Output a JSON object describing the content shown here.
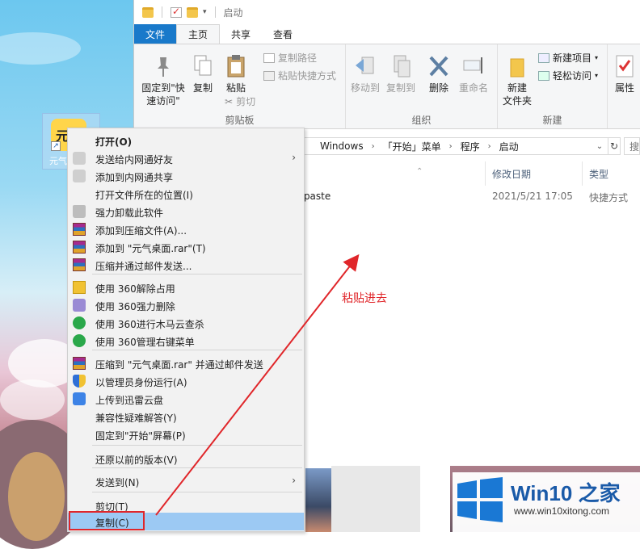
{
  "explorer": {
    "title": "启动",
    "tabs": [
      "文件",
      "主页",
      "共享",
      "查看"
    ],
    "ribbon": {
      "pin_label": "固定到\"快\n速访问\"",
      "copy_label": "复制",
      "paste_label": "粘贴",
      "copy_path_label": "复制路径",
      "paste_shortcut_label": "粘贴快捷方式",
      "cut_label": "剪切",
      "clipboard_group": "剪贴板",
      "move_to_label": "移动到",
      "copy_to_label": "复制到",
      "delete_label": "删除",
      "rename_label": "重命名",
      "organize_group": "组织",
      "new_item_label": "新建项目",
      "easy_access_label": "轻松访问",
      "new_folder_label": "新建\n文件夹",
      "new_group": "新建",
      "properties_label": "属性"
    },
    "address": {
      "crumbs": [
        "Windows",
        "「开始」菜单",
        "程序",
        "启动"
      ],
      "search_placeholder": "搜"
    },
    "columns": {
      "name": "",
      "date": "修改日期",
      "type": "类型"
    },
    "files": [
      {
        "name": "nipaste",
        "date": "2021/5/21 17:05",
        "type": "快捷方式"
      }
    ]
  },
  "desktop_icon": {
    "glyph": "元气",
    "label": "元气"
  },
  "context_menu": {
    "items": [
      {
        "label": "打开(O)",
        "icon": "none",
        "bold": true
      },
      {
        "label": "发送给内网通好友",
        "icon": "share-icon",
        "submenu": true
      },
      {
        "label": "添加到内网通共享",
        "icon": "share-icon"
      },
      {
        "label": "打开文件所在的位置(I)",
        "icon": "none"
      },
      {
        "label": "强力卸载此软件",
        "icon": "trash-icon"
      },
      {
        "label": "添加到压缩文件(A)...",
        "icon": "rar-icon"
      },
      {
        "label": "添加到 \"元气桌面.rar\"(T)",
        "icon": "rar-icon"
      },
      {
        "label": "压缩并通过邮件发送...",
        "icon": "rar-icon"
      },
      {
        "label": "使用 360解除占用",
        "icon": "360-unlock-icon"
      },
      {
        "label": "使用 360强力删除",
        "icon": "360-delete-icon"
      },
      {
        "label": "使用 360进行木马云查杀",
        "icon": "360-scan-icon"
      },
      {
        "label": "使用 360管理右键菜单",
        "icon": "360-menu-icon"
      },
      {
        "label": "压缩到 \"元气桌面.rar\" 并通过邮件发送",
        "icon": "rar-icon"
      },
      {
        "label": "以管理员身份运行(A)",
        "icon": "shield-icon"
      },
      {
        "label": "上传到迅雷云盘",
        "icon": "xunlei-icon"
      },
      {
        "label": "兼容性疑难解答(Y)",
        "icon": "none"
      },
      {
        "label": "固定到\"开始\"屏幕(P)",
        "icon": "none"
      },
      {
        "label": "还原以前的版本(V)",
        "icon": "none"
      },
      {
        "label": "发送到(N)",
        "icon": "none",
        "submenu": true
      },
      {
        "label": "剪切(T)",
        "icon": "none"
      },
      {
        "label": "复制(C)",
        "icon": "none",
        "highlighted": true
      }
    ]
  },
  "annotation": {
    "text": "粘贴进去",
    "color": "#e0262a"
  },
  "watermark": {
    "brand_main": "Win10",
    "brand_suffix": "之家",
    "url": "www.win10xitong.com"
  },
  "colors": {
    "accent": "#1979ca",
    "highlight": "#9cc9f3",
    "annotation": "#e0262a"
  }
}
